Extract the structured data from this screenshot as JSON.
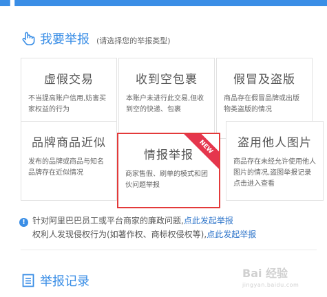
{
  "report_section": {
    "title": "我要举报",
    "subtitle": "(请选择您的举报类型)"
  },
  "cards": [
    {
      "title": "虚假交易",
      "desc": "不当提高账户信用,妨害买家权益的行为"
    },
    {
      "title": "收到空包裹",
      "desc": "本账户未进行此交易,但收到空的快递、包裹"
    },
    {
      "title": "假冒及盗版",
      "desc": "商品存在假冒品牌或出版物类盗版的情况"
    },
    {
      "title": "品牌商品近似",
      "desc": "发布的品牌或商品与知名品牌存在近似情况"
    },
    {
      "title": "情报举报",
      "desc": "商家售假、刷单的模式和团伙问题举报",
      "badge": "NEW"
    },
    {
      "title": "盗用他人图片",
      "desc": "商品存在未经允许使用他人图片的情况,盗图举报记录点击进入查看"
    }
  ],
  "notice": {
    "line1_text": "针对阿里巴巴员工或平台商家的廉政问题,",
    "line1_link": "点此发起举报",
    "line2_text": "权利人发现侵权行为(如著作权、商标权侵权等),",
    "line2_link": "点此发起举报"
  },
  "records_section": {
    "title": "举报记录"
  },
  "watermark": {
    "brand": "Bai 经验",
    "url": "jingyan.baidu.com"
  },
  "colors": {
    "accent": "#3a8ee6",
    "link": "#2b73c9",
    "highlight_border": "#e33a3a",
    "ribbon": "#e5364d"
  }
}
